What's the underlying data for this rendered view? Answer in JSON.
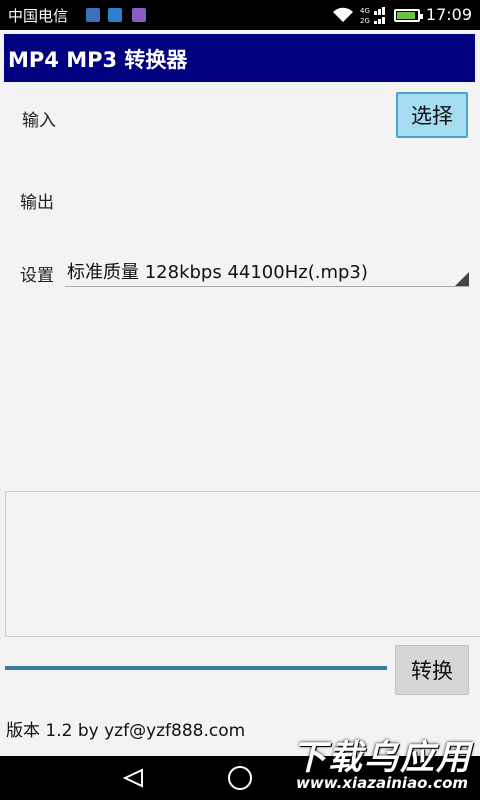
{
  "status_bar": {
    "carrier": "中国电信",
    "network": "4G 2G",
    "time": "17:09",
    "battery_level": 0.8,
    "notification_icons": [
      "weibo-icon",
      "usb-icon",
      "message-icon"
    ]
  },
  "app": {
    "title": "MP4 MP3 转换器"
  },
  "form": {
    "input_label": "输入",
    "select_label": "选择",
    "output_label": "输出",
    "settings_label": "设置",
    "settings_value": "标准质量 128kbps 44100Hz(.mp3)"
  },
  "actions": {
    "convert_label": "转换",
    "progress": 1.0
  },
  "footer": {
    "version_text": "版本 1.2 by yzf@yzf888.com"
  },
  "watermark": {
    "cn": "下载乌应用",
    "en": "www.xiazainiao.com"
  },
  "colors": {
    "title_bar": "#000080",
    "select_button": "#a6dcef",
    "progress": "#3a7d9c"
  }
}
